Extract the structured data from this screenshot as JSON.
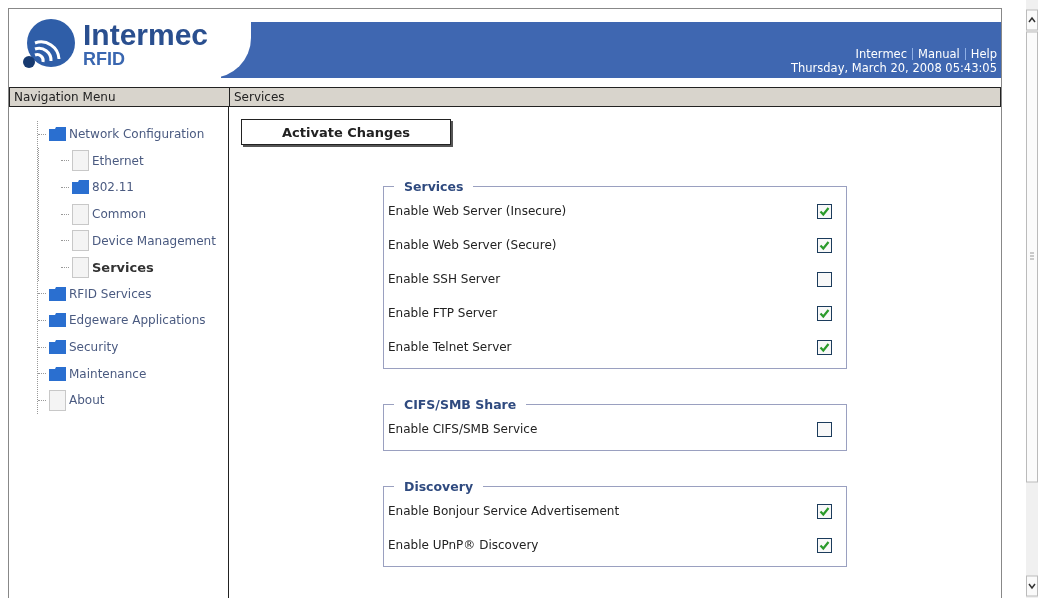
{
  "logo": {
    "name": "Intermec",
    "subtitle": "RFID"
  },
  "header_links": [
    "Intermec",
    "Manual",
    "Help"
  ],
  "datetime": "Thursday, March 20, 2008 05:43:05",
  "nav_title": "Navigation Menu",
  "page_title": "Services",
  "nav_tree": [
    {
      "label": "Network Configuration",
      "kind": "folder",
      "selected": false,
      "children": [
        {
          "label": "Ethernet",
          "kind": "page",
          "selected": false
        },
        {
          "label": "802.11",
          "kind": "folder",
          "selected": false
        },
        {
          "label": "Common",
          "kind": "page",
          "selected": false
        },
        {
          "label": "Device Management",
          "kind": "page",
          "selected": false
        },
        {
          "label": "Services",
          "kind": "page",
          "selected": true
        }
      ]
    },
    {
      "label": "RFID Services",
      "kind": "folder",
      "selected": false
    },
    {
      "label": "Edgeware Applications",
      "kind": "folder",
      "selected": false
    },
    {
      "label": "Security",
      "kind": "folder",
      "selected": false
    },
    {
      "label": "Maintenance",
      "kind": "folder",
      "selected": false
    },
    {
      "label": "About",
      "kind": "page",
      "selected": false
    }
  ],
  "activate_button": "Activate Changes",
  "groups": [
    {
      "title": "Services",
      "options": [
        {
          "label": "Enable Web Server (Insecure)",
          "checked": true
        },
        {
          "label": "Enable Web Server (Secure)",
          "checked": true
        },
        {
          "label": "Enable SSH Server",
          "checked": false
        },
        {
          "label": "Enable FTP Server",
          "checked": true
        },
        {
          "label": "Enable Telnet Server",
          "checked": true
        }
      ]
    },
    {
      "title": "CIFS/SMB Share",
      "options": [
        {
          "label": "Enable CIFS/SMB Service",
          "checked": false
        }
      ]
    },
    {
      "title": "Discovery",
      "options": [
        {
          "label": "Enable Bonjour Service Advertisement",
          "checked": true
        },
        {
          "label": "Enable UPnP® Discovery",
          "checked": true
        }
      ]
    }
  ]
}
